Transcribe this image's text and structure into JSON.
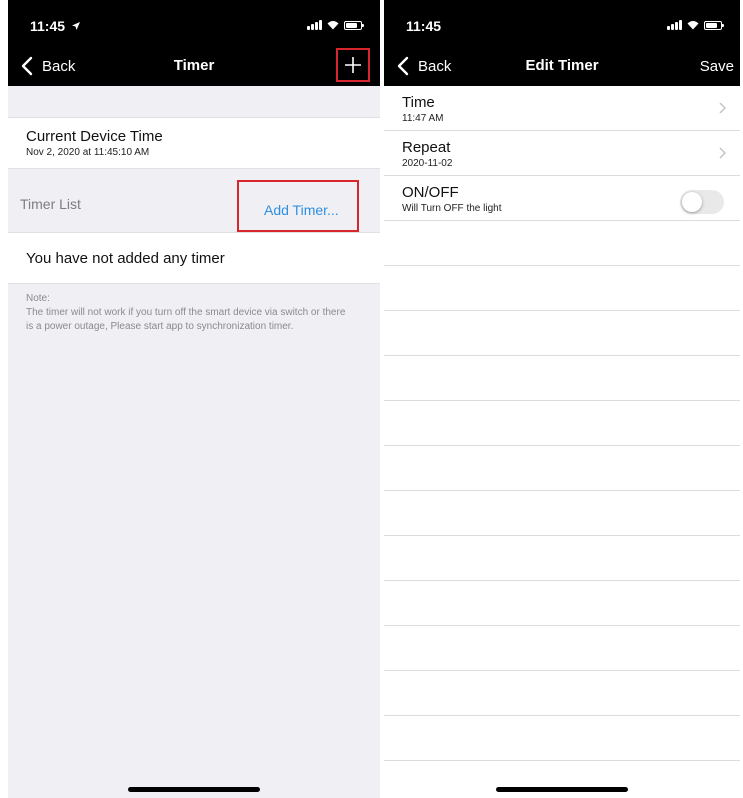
{
  "timer_screen": {
    "status_time": "11:45",
    "back_label": "Back",
    "title": "Timer",
    "device_time_title": "Current Device Time",
    "device_time_value": "Nov 2, 2020 at 11:45:10 AM",
    "timer_list_label": "Timer List",
    "add_timer_label": "Add Timer...",
    "empty_message": "You have not added any timer",
    "note_title": "Note:",
    "note_body": "The timer will not work if you turn off the smart device via switch or there is a power outage, Please start app to synchronization timer."
  },
  "edit_screen": {
    "status_time": "11:45",
    "back_label": "Back",
    "title": "Edit Timer",
    "save_label": "Save",
    "time_label": "Time",
    "time_value": "11:47 AM",
    "repeat_label": "Repeat",
    "repeat_value": "2020-11-02",
    "onoff_label": "ON/OFF",
    "onoff_value": "Will Turn OFF the light",
    "toggle_on": false
  },
  "colors": {
    "highlight_red": "#d7262c",
    "link_blue": "#2f8fe0",
    "nav_bar": "#000000",
    "grouped_bg": "#efeff4"
  },
  "icons": [
    "location-arrow-icon",
    "signal-icon",
    "wifi-icon",
    "battery-icon",
    "chevron-left-icon",
    "plus-icon",
    "chevron-right-icon"
  ]
}
